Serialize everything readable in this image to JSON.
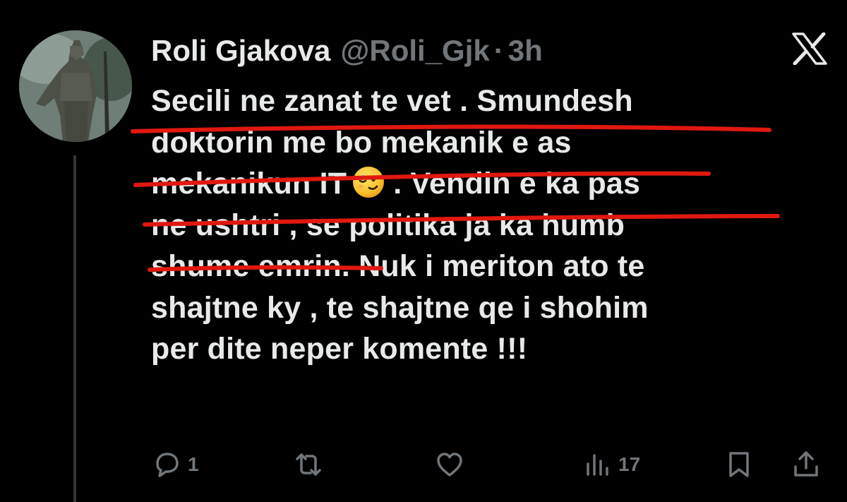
{
  "tweet": {
    "display_name": "Roli Gjakova",
    "handle": "@Roli_Gjk",
    "separator": "·",
    "time": "3h",
    "text_lines": [
      "Secili ne zanat te vet . Smundesh",
      "doktorin me bo mekanik e as",
      "mekanikun IT",
      ". Vendin e ka pas",
      "ne ushtri , se politika ja ka humb",
      "shume emrin. Nuk i meriton ato te",
      "shajtne ky , te shajtne qe i shohim",
      "per dite neper komente !!!"
    ],
    "emoji": "winking-face-emoji",
    "annotation_color": "#e0180f"
  },
  "actions": {
    "reply_count": "1",
    "retweet_count": "",
    "like_count": "",
    "views_count": "17"
  },
  "icons": {
    "brand": "x-logo-icon",
    "reply": "reply-icon",
    "retweet": "retweet-icon",
    "like": "heart-icon",
    "views": "views-icon",
    "bookmark": "bookmark-icon",
    "share": "share-icon"
  },
  "colors": {
    "background": "#000000",
    "text_primary": "#e7e9ea",
    "text_secondary": "#71767b",
    "thread_line": "#333639"
  }
}
